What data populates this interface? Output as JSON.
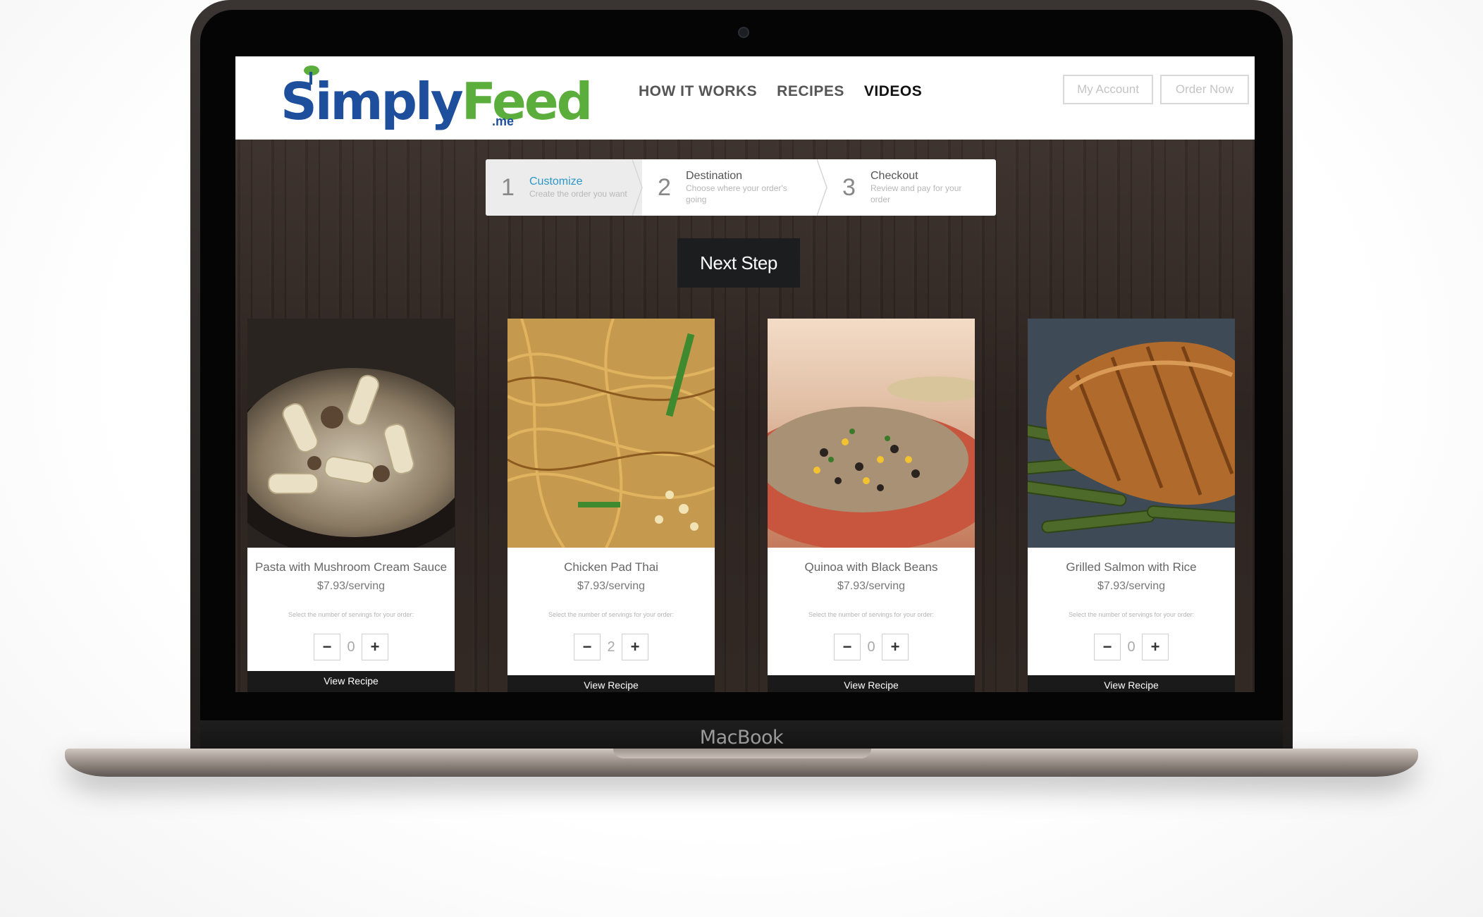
{
  "device": {
    "brand": "MacBook"
  },
  "header": {
    "logo": {
      "part1": "Simply",
      "part2": "Feed",
      "suffix": ".me"
    },
    "nav": [
      {
        "label": "HOW IT WORKS",
        "active": false
      },
      {
        "label": "RECIPES",
        "active": false
      },
      {
        "label": "VIDEOS",
        "active": true
      }
    ],
    "my_account": "My Account",
    "order_now": "Order Now"
  },
  "steps": [
    {
      "num": "1",
      "title": "Customize",
      "desc": "Create the order you want",
      "active": true
    },
    {
      "num": "2",
      "title": "Destination",
      "desc": "Choose where your order's going",
      "active": false
    },
    {
      "num": "3",
      "title": "Checkout",
      "desc": "Review and pay for your order",
      "active": false
    }
  ],
  "next_button": "Next Step",
  "recipes": [
    {
      "title": "Pasta with Mushroom Cream Sauce",
      "price": "$7.93/serving",
      "hint": "Select the number of servings for your order:",
      "qty": "0",
      "view": "View Recipe",
      "minus": "−",
      "plus": "+"
    },
    {
      "title": "Chicken Pad Thai",
      "price": "$7.93/serving",
      "hint": "Select the number of servings for your order:",
      "qty": "2",
      "view": "View Recipe",
      "minus": "−",
      "plus": "+"
    },
    {
      "title": "Quinoa with Black Beans",
      "price": "$7.93/serving",
      "hint": "Select the number of servings for your order:",
      "qty": "0",
      "view": "View Recipe",
      "minus": "−",
      "plus": "+"
    },
    {
      "title": "Grilled Salmon with Rice",
      "price": "$7.93/serving",
      "hint": "Select the number of servings for your order:",
      "qty": "0",
      "view": "View Recipe",
      "minus": "−",
      "plus": "+"
    }
  ],
  "colors": {
    "brand_blue": "#1e4f9c",
    "brand_green": "#5cae3c",
    "active_step": "#2b97c9",
    "button_dark": "#1c1d1f"
  }
}
